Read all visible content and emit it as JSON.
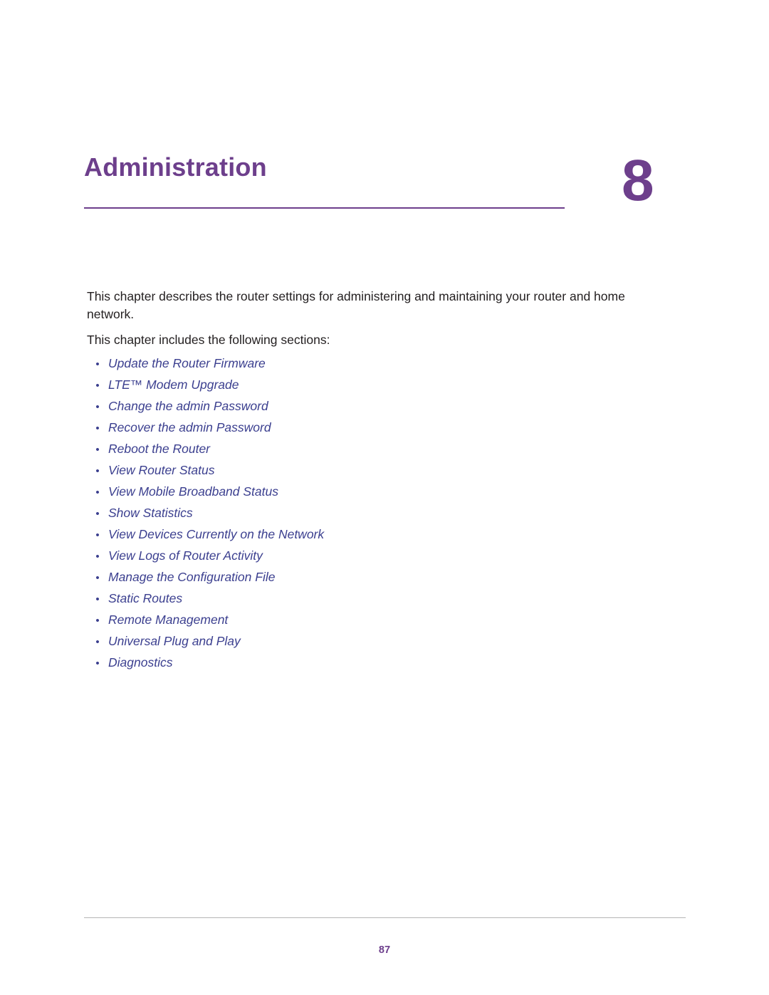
{
  "chapter": {
    "title": "Administration",
    "number": "8"
  },
  "intro": {
    "paragraph1": "This chapter describes the router settings for administering and maintaining your router and home network.",
    "paragraph2": "This chapter includes the following sections:"
  },
  "toc": {
    "bullet": "•",
    "items": [
      {
        "label": "Update the Router Firmware"
      },
      {
        "label": "LTE™ Modem Upgrade"
      },
      {
        "label": "Change the admin Password"
      },
      {
        "label": "Recover the admin Password"
      },
      {
        "label": "Reboot the Router"
      },
      {
        "label": "View Router Status"
      },
      {
        "label": "View Mobile Broadband Status"
      },
      {
        "label": "Show Statistics"
      },
      {
        "label": "View Devices Currently on the Network"
      },
      {
        "label": "View Logs of Router Activity"
      },
      {
        "label": "Manage the Configuration File"
      },
      {
        "label": "Static Routes"
      },
      {
        "label": "Remote Management"
      },
      {
        "label": "Universal Plug and Play"
      },
      {
        "label": "Diagnostics"
      }
    ]
  },
  "footer": {
    "page_number": "87"
  },
  "colors": {
    "accent_purple": "#6d3f8c",
    "link_blue": "#3b3f8f",
    "body_text": "#231f20",
    "rule_gray": "#b6b6b6"
  }
}
